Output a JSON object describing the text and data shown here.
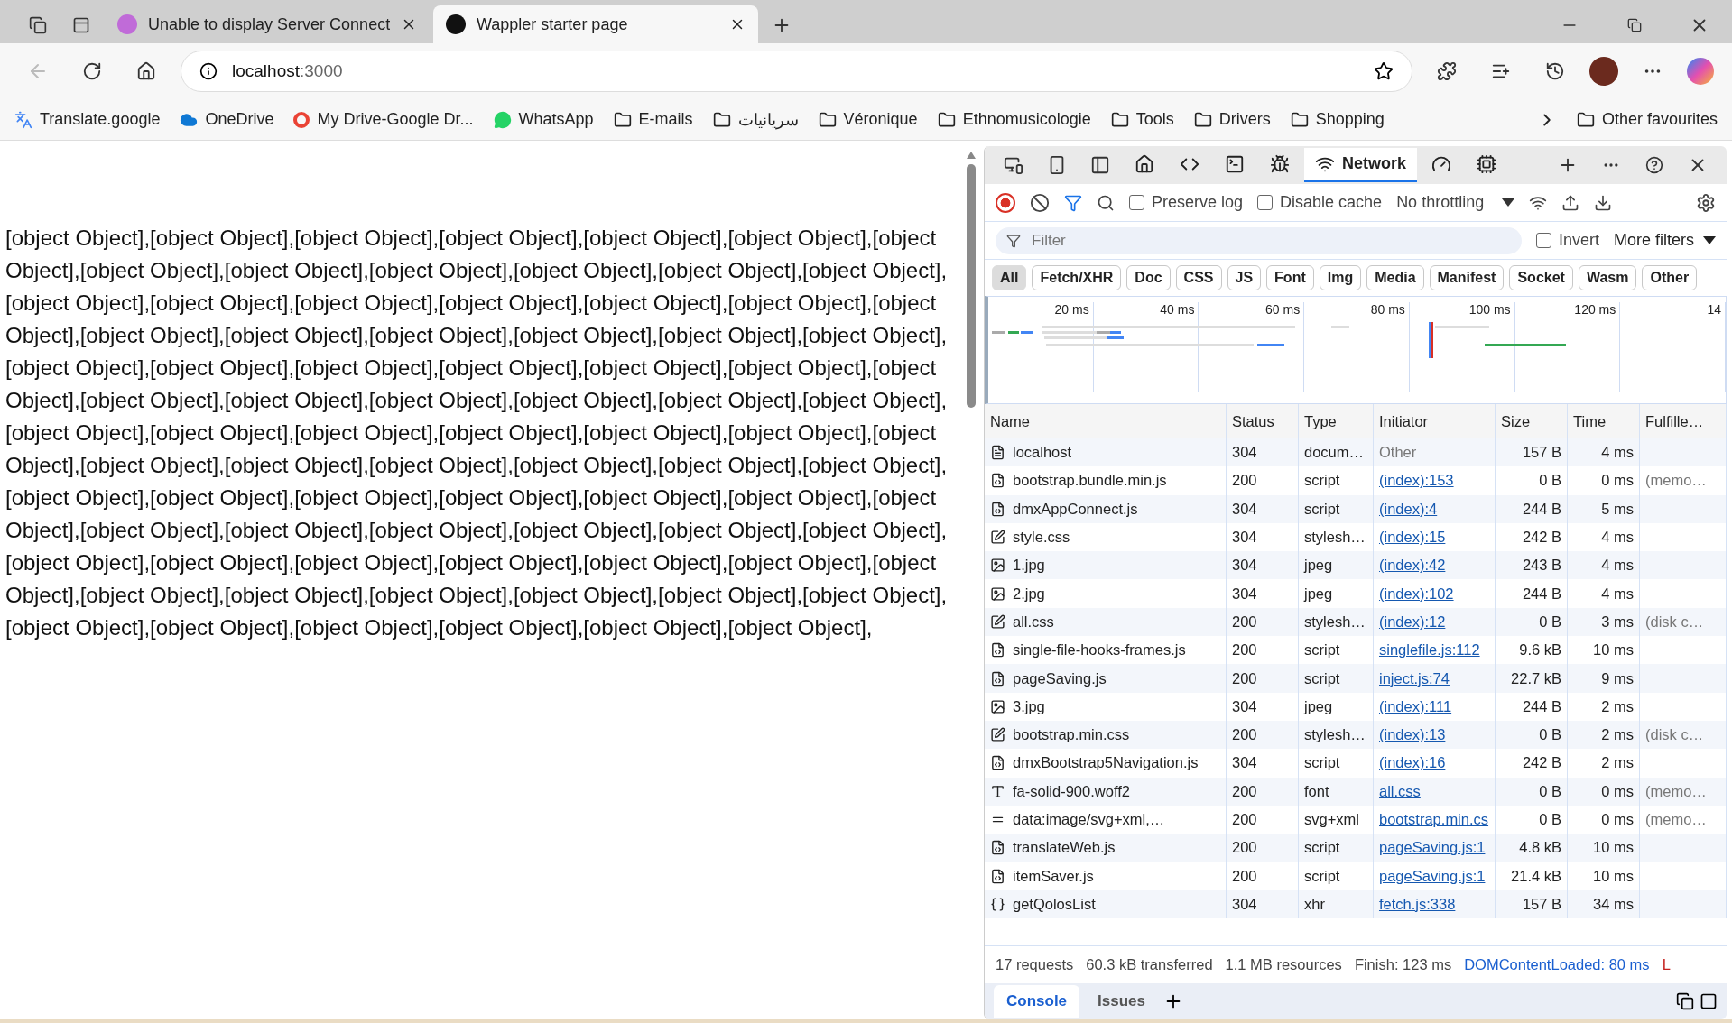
{
  "browser_tabs": [
    {
      "title": "Unable to display Server Connect",
      "selected": false
    },
    {
      "title": "Wappler starter page",
      "selected": true
    }
  ],
  "address": {
    "host": "localhost",
    "port": ":3000"
  },
  "bookmarks": [
    {
      "label": "Translate.google",
      "kind": "translate"
    },
    {
      "label": "OneDrive",
      "kind": "cloud"
    },
    {
      "label": "My Drive-Google Dr...",
      "kind": "google"
    },
    {
      "label": "WhatsApp",
      "kind": "chat"
    },
    {
      "label": "E-mails",
      "kind": "folder"
    },
    {
      "label": "سريانيات",
      "kind": "folder"
    },
    {
      "label": "Véronique",
      "kind": "folder"
    },
    {
      "label": "Ethnomusicologie",
      "kind": "folder"
    },
    {
      "label": "Tools",
      "kind": "folder"
    },
    {
      "label": "Drivers",
      "kind": "folder"
    },
    {
      "label": "Shopping",
      "kind": "folder"
    }
  ],
  "other_favourites": "Other favourites",
  "page_text": "[object Object],[object Object],[object Object],[object Object],[object Object],[object Object],[object Object],[object Object],[object Object],[object Object],[object Object],[object Object],[object Object],[object Object],[object Object],[object Object],[object Object],[object Object],[object Object],[object Object],[object Object],[object Object],[object Object],[object Object],[object Object],[object Object],[object Object],[object Object],[object Object],[object Object],[object Object],[object Object],[object Object],[object Object],[object Object],[object Object],[object Object],[object Object],[object Object],[object Object],[object Object],[object Object],[object Object],[object Object],[object Object],[object Object],[object Object],[object Object],[object Object],[object Object],[object Object],[object Object],[object Object],[object Object],[object Object],[object Object],[object Object],[object Object],[object Object],[object Object],[object Object],[object Object],[object Object],[object Object],[object Object],[object Object],[object Object],[object Object],[object Object],[object Object],[object Object],[object Object],[object Object],[object Object],[object Object],[object Object],[object Object],[object Object],[object Object],[object Object],[object Object],[object Object],[object Object],[object Object],",
  "devtools": {
    "panel_tabs": [
      {
        "kind": "home",
        "selected": false
      },
      {
        "kind": "elements",
        "selected": false
      },
      {
        "kind": "console",
        "selected": false
      },
      {
        "kind": "sources",
        "selected": false
      },
      {
        "kind": "network",
        "label": "Network",
        "selected": true
      },
      {
        "kind": "performance",
        "selected": false
      },
      {
        "kind": "memory",
        "selected": false
      }
    ],
    "preserve_log": {
      "label": "Preserve log",
      "checked": false
    },
    "disable_cache": {
      "label": "Disable cache",
      "checked": false
    },
    "throttling": "No throttling",
    "filter": {
      "placeholder": "Filter"
    },
    "invert": {
      "label": "Invert",
      "checked": false
    },
    "more_filters": "More filters",
    "type_filters": [
      {
        "label": "All",
        "selected": true
      },
      {
        "label": "Fetch/XHR",
        "selected": false
      },
      {
        "label": "Doc",
        "selected": false
      },
      {
        "label": "CSS",
        "selected": false
      },
      {
        "label": "JS",
        "selected": false
      },
      {
        "label": "Font",
        "selected": false
      },
      {
        "label": "Img",
        "selected": false
      },
      {
        "label": "Media",
        "selected": false
      },
      {
        "label": "Manifest",
        "selected": false
      },
      {
        "label": "Socket",
        "selected": false
      },
      {
        "label": "Wasm",
        "selected": false
      },
      {
        "label": "Other",
        "selected": false
      }
    ],
    "timeline_ticks": [
      "20 ms",
      "40 ms",
      "60 ms",
      "80 ms",
      "100 ms",
      "120 ms",
      "14"
    ],
    "columns": [
      "Name",
      "Status",
      "Type",
      "Initiator",
      "Size",
      "Time",
      "Fulfille…"
    ],
    "rows": [
      {
        "kind": "document",
        "name": "localhost",
        "status": "304",
        "type": "docum…",
        "initiator": "Other",
        "initiator_link": false,
        "size": "157 B",
        "time": "4 ms"
      },
      {
        "kind": "script",
        "name": "bootstrap.bundle.min.js",
        "status": "200",
        "type": "script",
        "initiator": "(index):153",
        "initiator_link": true,
        "size": "0 B",
        "time": "0 ms",
        "fulfilled": "(memo…"
      },
      {
        "kind": "script",
        "name": "dmxAppConnect.js",
        "status": "304",
        "type": "script",
        "initiator": "(index):4",
        "initiator_link": true,
        "size": "244 B",
        "time": "5 ms"
      },
      {
        "kind": "stylesheet",
        "name": "style.css",
        "status": "304",
        "type": "stylesh…",
        "initiator": "(index):15",
        "initiator_link": true,
        "size": "242 B",
        "time": "4 ms"
      },
      {
        "kind": "image",
        "name": "1.jpg",
        "status": "304",
        "type": "jpeg",
        "initiator": "(index):42",
        "initiator_link": true,
        "size": "243 B",
        "time": "4 ms"
      },
      {
        "kind": "image",
        "name": "2.jpg",
        "status": "304",
        "type": "jpeg",
        "initiator": "(index):102",
        "initiator_link": true,
        "size": "244 B",
        "time": "4 ms"
      },
      {
        "kind": "stylesheet",
        "name": "all.css",
        "status": "200",
        "type": "stylesh…",
        "initiator": "(index):12",
        "initiator_link": true,
        "size": "0 B",
        "time": "3 ms",
        "fulfilled": "(disk c…"
      },
      {
        "kind": "script",
        "name": "single-file-hooks-frames.js",
        "status": "200",
        "type": "script",
        "initiator": "singlefile.js:112",
        "initiator_link": true,
        "size": "9.6 kB",
        "time": "10 ms"
      },
      {
        "kind": "script",
        "name": "pageSaving.js",
        "status": "200",
        "type": "script",
        "initiator": "inject.js:74",
        "initiator_link": true,
        "size": "22.7 kB",
        "time": "9 ms"
      },
      {
        "kind": "image",
        "name": "3.jpg",
        "status": "304",
        "type": "jpeg",
        "initiator": "(index):111",
        "initiator_link": true,
        "size": "244 B",
        "time": "2 ms"
      },
      {
        "kind": "stylesheet",
        "name": "bootstrap.min.css",
        "status": "200",
        "type": "stylesh…",
        "initiator": "(index):13",
        "initiator_link": true,
        "size": "0 B",
        "time": "2 ms",
        "fulfilled": "(disk c…"
      },
      {
        "kind": "script",
        "name": "dmxBootstrap5Navigation.js",
        "status": "304",
        "type": "script",
        "initiator": "(index):16",
        "initiator_link": true,
        "size": "242 B",
        "time": "2 ms"
      },
      {
        "kind": "font",
        "name": "fa-solid-900.woff2",
        "status": "200",
        "type": "font",
        "initiator": "all.css",
        "initiator_link": true,
        "size": "0 B",
        "time": "0 ms",
        "fulfilled": "(memo…"
      },
      {
        "kind": "data",
        "name": "data:image/svg+xml,…",
        "status": "200",
        "type": "svg+xml",
        "initiator": "bootstrap.min.cs",
        "initiator_link": true,
        "size": "0 B",
        "time": "0 ms",
        "fulfilled": "(memo…"
      },
      {
        "kind": "script",
        "name": "translateWeb.js",
        "status": "200",
        "type": "script",
        "initiator": "pageSaving.js:1",
        "initiator_link": true,
        "size": "4.8 kB",
        "time": "10 ms"
      },
      {
        "kind": "script",
        "name": "itemSaver.js",
        "status": "200",
        "type": "script",
        "initiator": "pageSaving.js:1",
        "initiator_link": true,
        "size": "21.4 kB",
        "time": "10 ms"
      },
      {
        "kind": "xhr",
        "name": "getQolosList",
        "status": "304",
        "type": "xhr",
        "initiator": "fetch.js:338",
        "initiator_link": true,
        "size": "157 B",
        "time": "34 ms"
      }
    ],
    "summary": [
      "17 requests",
      "60.3 kB transferred",
      "1.1 MB resources",
      "Finish: 123 ms"
    ],
    "dom_content_loaded": "DOMContentLoaded: 80 ms",
    "load": "L",
    "drawer_tabs": [
      {
        "label": "Console",
        "selected": true
      },
      {
        "label": "Issues",
        "selected": false
      }
    ]
  }
}
